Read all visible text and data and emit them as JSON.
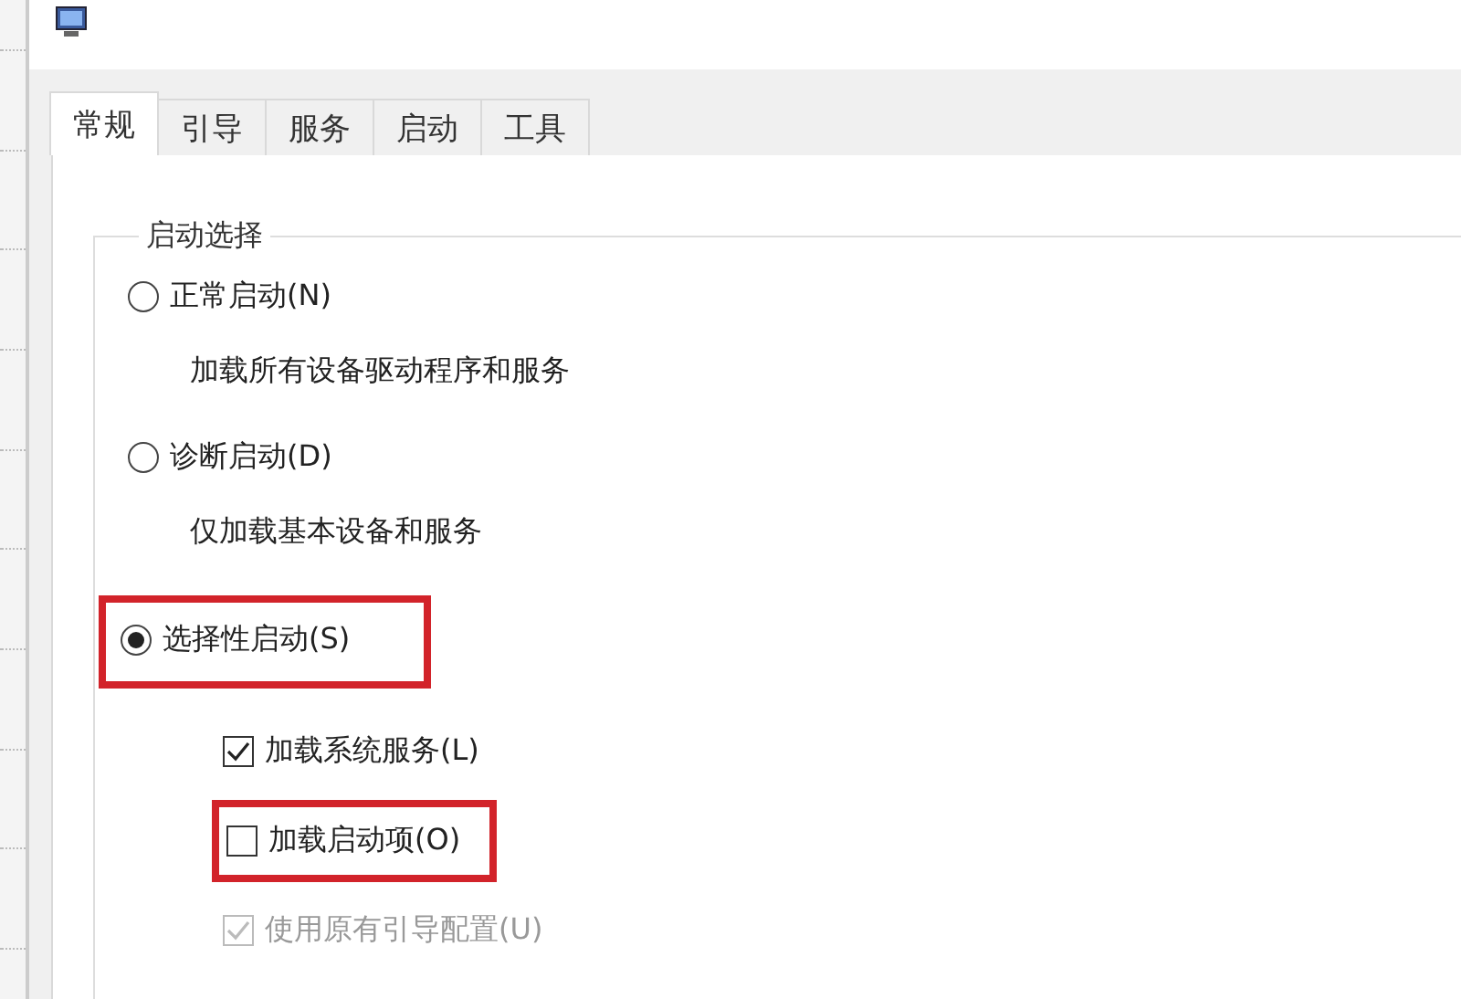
{
  "tabs": [
    {
      "label": "常规",
      "selected": true
    },
    {
      "label": "引导",
      "selected": false
    },
    {
      "label": "服务",
      "selected": false
    },
    {
      "label": "启动",
      "selected": false
    },
    {
      "label": "工具",
      "selected": false
    }
  ],
  "group": {
    "title": "启动选择",
    "options": [
      {
        "label": "正常启动(N)",
        "selected": false,
        "highlighted": false,
        "description": "加载所有设备驱动程序和服务"
      },
      {
        "label": "诊断启动(D)",
        "selected": false,
        "highlighted": false,
        "description": "仅加载基本设备和服务"
      },
      {
        "label": "选择性启动(S)",
        "selected": true,
        "highlighted": true
      }
    ],
    "checkboxes": [
      {
        "label": "加载系统服务(L)",
        "checked": true,
        "disabled": false,
        "highlighted": false
      },
      {
        "label": "加载启动项(O)",
        "checked": false,
        "disabled": false,
        "highlighted": true
      },
      {
        "label": "使用原有引导配置(U)",
        "checked": true,
        "disabled": true,
        "highlighted": false
      }
    ]
  }
}
